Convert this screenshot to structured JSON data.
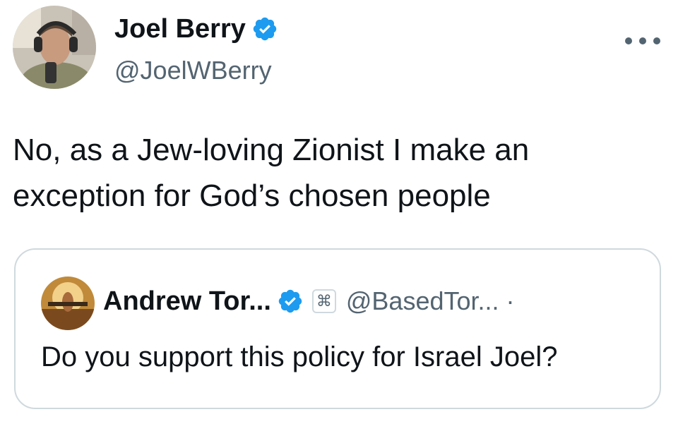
{
  "tweet": {
    "author": {
      "name": "Joel Berry",
      "handle": "@JoelWBerry",
      "verified": true,
      "avatar_icon": "profile-photo"
    },
    "more_icon": "more-options-icon",
    "text": "No, as a Jew-loving Zionist I make an exception for God’s chosen people"
  },
  "quoted_tweet": {
    "author": {
      "name": "Andrew Tor...",
      "handle": "@BasedTor...",
      "verified": true,
      "affiliate_badge_glyph": "⌘",
      "avatar_icon": "profile-photo"
    },
    "separator": "·",
    "text": "Do you support this policy for Israel Joel?"
  },
  "colors": {
    "verified_blue": "#1d9bf0",
    "text_primary": "#0f1419",
    "text_secondary": "#536471",
    "border": "#cfd9de"
  }
}
